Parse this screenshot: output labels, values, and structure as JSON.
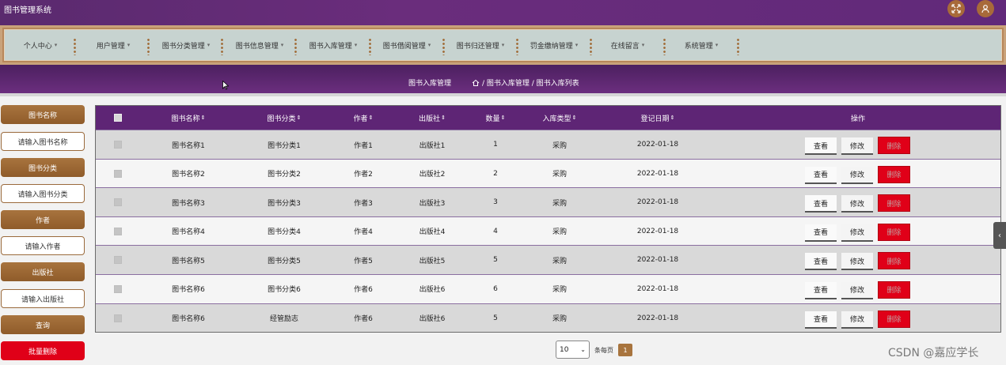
{
  "app": {
    "title": "图书管理系统"
  },
  "top_icons": [
    {
      "name": "fullscreen-icon"
    },
    {
      "name": "user-icon"
    }
  ],
  "nav": {
    "items": [
      {
        "label": "个人中心"
      },
      {
        "label": "用户管理"
      },
      {
        "label": "图书分类管理"
      },
      {
        "label": "图书信息管理"
      },
      {
        "label": "图书入库管理"
      },
      {
        "label": "图书借阅管理"
      },
      {
        "label": "图书归还管理"
      },
      {
        "label": "罚金缴纳管理"
      },
      {
        "label": "在线留言"
      },
      {
        "label": "系统管理"
      }
    ]
  },
  "breadcrumb": {
    "title": "图书入库管理",
    "path": "/ 图书入库管理 / 图书入库列表"
  },
  "sidebar": {
    "fields": [
      {
        "label": "图书名称",
        "placeholder": "请输入图书名称"
      },
      {
        "label": "图书分类",
        "placeholder": "请输入图书分类"
      },
      {
        "label": "作者",
        "placeholder": "请输入作者"
      },
      {
        "label": "出版社",
        "placeholder": "请输入出版社"
      }
    ],
    "search_label": "查询",
    "batch_delete_label": "批量删除"
  },
  "table": {
    "columns": [
      "图书名称",
      "图书分类",
      "作者",
      "出版社",
      "数量",
      "入库类型",
      "登记日期"
    ],
    "actions_header": "操作",
    "action_labels": {
      "view": "查看",
      "edit": "修改",
      "delete": "删除"
    },
    "rows": [
      [
        "图书名称1",
        "图书分类1",
        "作者1",
        "出版社1",
        "1",
        "采购",
        "2022-01-18"
      ],
      [
        "图书名称2",
        "图书分类2",
        "作者2",
        "出版社2",
        "2",
        "采购",
        "2022-01-18"
      ],
      [
        "图书名称3",
        "图书分类3",
        "作者3",
        "出版社3",
        "3",
        "采购",
        "2022-01-18"
      ],
      [
        "图书名称4",
        "图书分类4",
        "作者4",
        "出版社4",
        "4",
        "采购",
        "2022-01-18"
      ],
      [
        "图书名称5",
        "图书分类5",
        "作者5",
        "出版社5",
        "5",
        "采购",
        "2022-01-18"
      ],
      [
        "图书名称6",
        "图书分类6",
        "作者6",
        "出版社6",
        "6",
        "采购",
        "2022-01-18"
      ],
      [
        "图书名称6",
        "经管励志",
        "作者6",
        "出版社6",
        "5",
        "采购",
        "2022-01-18"
      ]
    ]
  },
  "pagination": {
    "page_size": "10",
    "per_page_label": "条每页",
    "current_page": "1"
  },
  "watermark": "CSDN @嘉应学长",
  "colors": {
    "primary_purple": "#5e2575",
    "accent_brown": "#a8743e",
    "danger_red": "#e00018"
  }
}
